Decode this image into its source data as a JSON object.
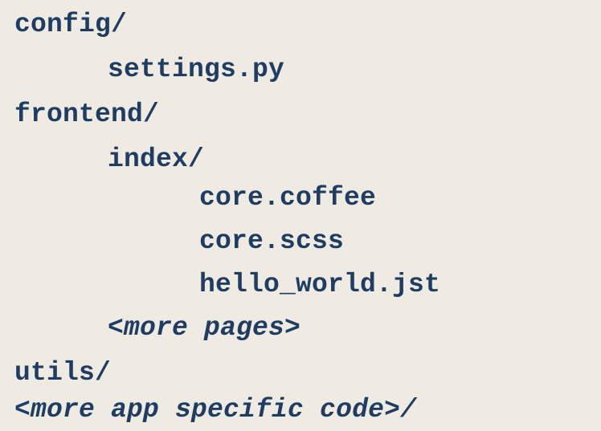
{
  "tree": {
    "items": [
      {
        "text": "config/"
      },
      {
        "text": "settings.py"
      },
      {
        "text": "frontend/"
      },
      {
        "text": "index/"
      },
      {
        "text": "core.coffee"
      },
      {
        "text": "core.scss"
      },
      {
        "text": "hello_world.jst"
      },
      {
        "text": "<more pages>"
      },
      {
        "text": "utils/"
      },
      {
        "text": "<more app specific code>/"
      }
    ]
  },
  "colors": {
    "background": "#efebe3",
    "text": "#1f3d63"
  }
}
